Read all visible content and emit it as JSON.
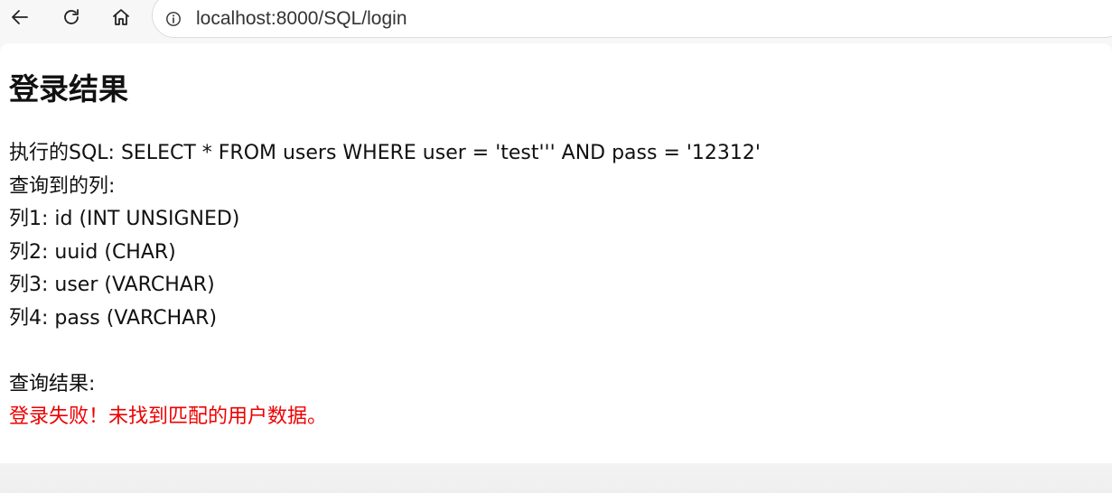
{
  "browser": {
    "url": "localhost:8000/SQL/login",
    "icons": {
      "back": "arrow-left-icon",
      "reload": "reload-icon",
      "home": "home-icon",
      "site_info": "info-icon"
    }
  },
  "page": {
    "title": "登录结果",
    "sql_line": "执行的SQL: SELECT * FROM users WHERE user = 'test''' AND pass = '12312'",
    "columns_heading": "查询到的列:",
    "columns": [
      "列1: id (INT UNSIGNED)",
      "列2: uuid (CHAR)",
      "列3: user (VARCHAR)",
      "列4: pass (VARCHAR)"
    ],
    "result_heading": "查询结果:",
    "result_message": "登录失败！未找到匹配的用户数据。"
  },
  "colors": {
    "error": "#ee0000",
    "text": "#111111",
    "toolbar_bg": "#f7f7f7"
  }
}
